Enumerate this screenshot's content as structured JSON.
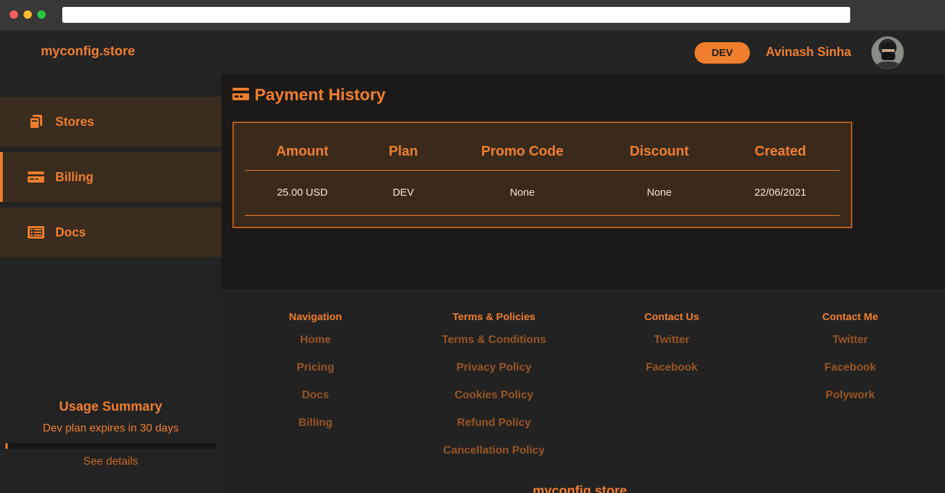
{
  "header": {
    "brand": "myconfig.store",
    "plan_badge": "DEV",
    "username": "Avinash Sinha",
    "avatar_icon": "user-avatar"
  },
  "sidebar": {
    "items": [
      {
        "label": "Stores",
        "icon": "stores-icon",
        "active": false
      },
      {
        "label": "Billing",
        "icon": "billing-card-icon",
        "active": true
      },
      {
        "label": "Docs",
        "icon": "docs-icon",
        "active": false
      }
    ],
    "usage": {
      "title": "Usage Summary",
      "subtitle": "Dev plan expires in 30 days",
      "progress": 0.01,
      "link": "See details"
    }
  },
  "main": {
    "title": "Payment History",
    "title_icon": "credit-card-icon",
    "columns": [
      "Amount",
      "Plan",
      "Promo Code",
      "Discount",
      "Created"
    ],
    "rows": [
      [
        "25.00 USD",
        "DEV",
        "None",
        "None",
        "22/06/2021"
      ]
    ]
  },
  "footer": {
    "columns": [
      {
        "heading": "Navigation",
        "links": [
          "Home",
          "Pricing",
          "Docs",
          "Billing"
        ]
      },
      {
        "heading": "Terms & Policies",
        "links": [
          "Terms & Conditions",
          "Privacy Policy",
          "Cookies Policy",
          "Refund Policy",
          "Cancellation Policy"
        ]
      },
      {
        "heading": "Contact Us",
        "links": [
          "Twitter",
          "Facebook"
        ]
      },
      {
        "heading": "Contact Me",
        "links": [
          "Twitter",
          "Facebook",
          "Polywork"
        ]
      }
    ],
    "brand": "myconfig.store"
  },
  "colors": {
    "accent": "#f07e2c",
    "background": "#222222",
    "card": "#3a2a1c"
  }
}
